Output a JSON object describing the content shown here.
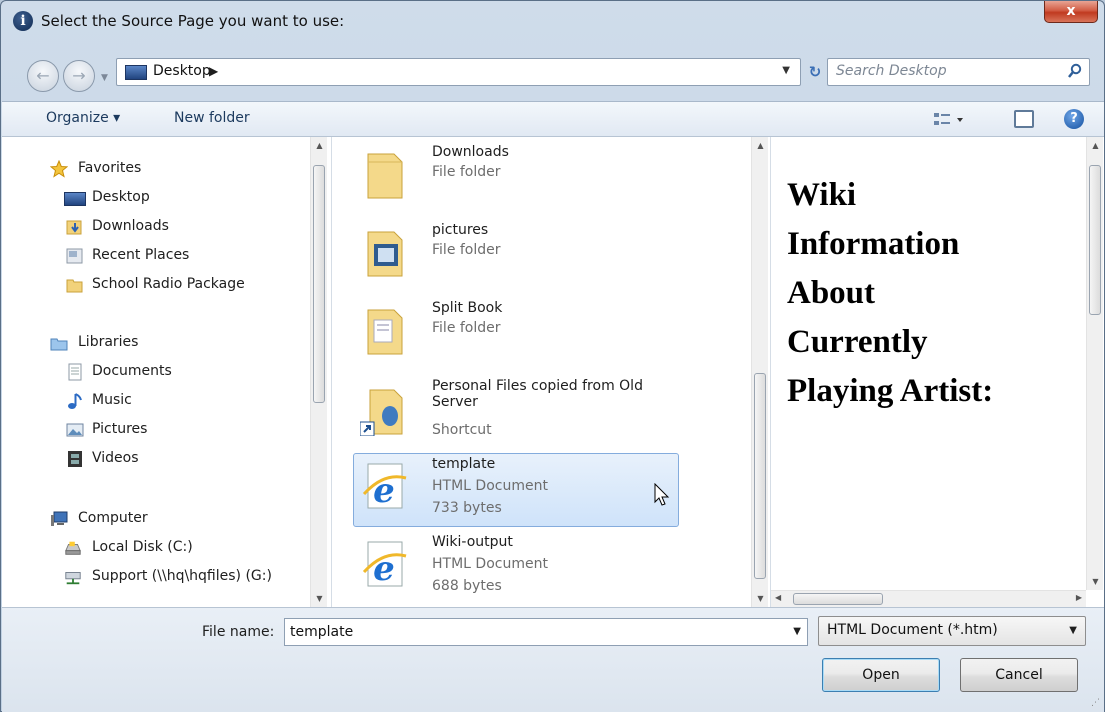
{
  "dialog": {
    "title": "Select the Source Page you want to use:",
    "close_label": "x"
  },
  "address_bar": {
    "location": "Desktop",
    "search_placeholder": "Search Desktop"
  },
  "toolbar": {
    "organize_label": "Organize ▾",
    "new_folder_label": "New folder"
  },
  "nav_pane": {
    "favorites_header": "Favorites",
    "favorites": [
      "Desktop",
      "Downloads",
      "Recent Places",
      "School Radio Package"
    ],
    "libraries_header": "Libraries",
    "libraries": [
      "Documents",
      "Music",
      "Pictures",
      "Videos"
    ],
    "computer_header": "Computer",
    "computer": [
      "Local Disk (C:)",
      "Support (\\\\hq\\hqfiles) (G:)"
    ]
  },
  "files": [
    {
      "name": "Downloads",
      "type": "File folder",
      "icon": "folder-icon"
    },
    {
      "name": "pictures",
      "type": "File folder",
      "icon": "folder-icon"
    },
    {
      "name": "Split Book",
      "type": "File folder",
      "icon": "folder-icon"
    },
    {
      "name": "Personal Files copied from Old Server",
      "type": "Shortcut",
      "icon": "folder-shortcut-icon"
    },
    {
      "name": "template",
      "type": "HTML Document",
      "size": "733 bytes",
      "icon": "ie-html-icon",
      "selected": true
    },
    {
      "name": "Wiki-output",
      "type": "HTML Document",
      "size": "688 bytes",
      "icon": "ie-html-icon"
    }
  ],
  "preview": {
    "lines": [
      "Wiki",
      "Information",
      "About",
      "Currently",
      "Playing Artist:"
    ]
  },
  "footer": {
    "file_name_label": "File name:",
    "file_name_value": "template",
    "file_type_value": "HTML Document (*.htm)",
    "open_label": "Open",
    "cancel_label": "Cancel"
  }
}
